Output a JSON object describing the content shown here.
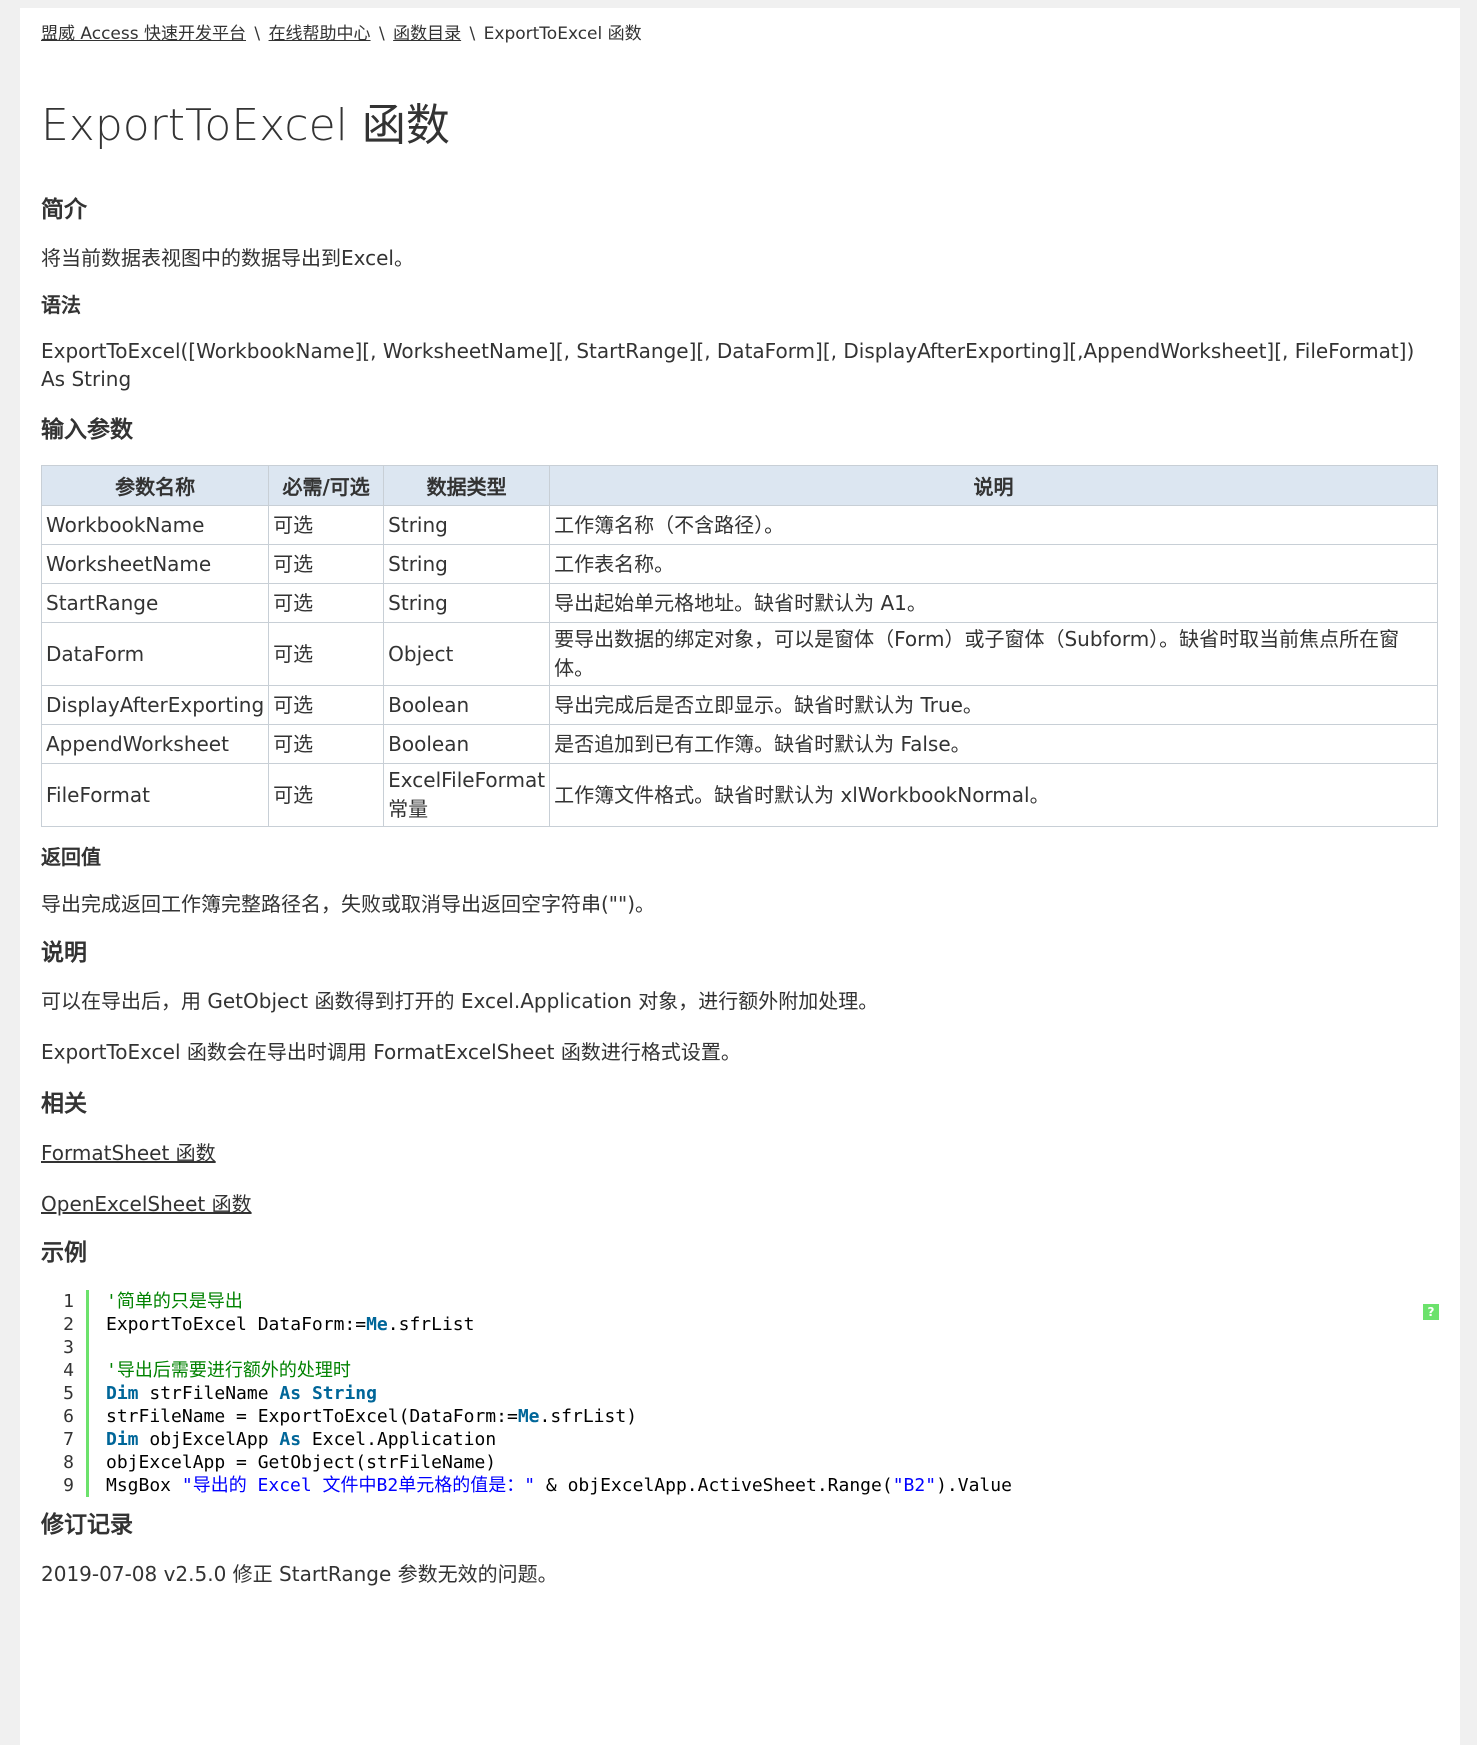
{
  "breadcrumb": {
    "items": [
      "盟威 Access 快速开发平台",
      "在线帮助中心",
      "函数目录"
    ],
    "separator": "\\",
    "current": "ExportToExcel 函数"
  },
  "title": "ExportToExcel 函数",
  "sections": {
    "summary": {
      "heading": "简介",
      "text": "将当前数据表视图中的数据导出到Excel。"
    },
    "syntax": {
      "heading": "语法",
      "text": "ExportToExcel([WorkbookName][, WorksheetName][, StartRange][, DataForm][, DisplayAfterExporting][,AppendWorksheet][, FileFormat]) As String"
    },
    "params": {
      "heading": "输入参数",
      "headers": [
        "参数名称",
        "必需/可选",
        "数据类型",
        "说明"
      ],
      "rows": [
        [
          "WorkbookName",
          "可选",
          "String",
          "工作簿名称（不含路径）。"
        ],
        [
          "WorksheetName",
          "可选",
          "String",
          "工作表名称。"
        ],
        [
          "StartRange",
          "可选",
          "String",
          "导出起始单元格地址。缺省时默认为 A1。"
        ],
        [
          "DataForm",
          "可选",
          "Object",
          "要导出数据的绑定对象，可以是窗体（Form）或子窗体（Subform）。缺省时取当前焦点所在窗体。"
        ],
        [
          "DisplayAfterExporting",
          "可选",
          "Boolean",
          "导出完成后是否立即显示。缺省时默认为 True。"
        ],
        [
          "AppendWorksheet",
          "可选",
          "Boolean",
          "是否追加到已有工作簿。缺省时默认为 False。"
        ],
        [
          "FileFormat",
          "可选",
          "ExcelFileFormat 常量",
          "工作簿文件格式。缺省时默认为 xlWorkbookNormal。"
        ]
      ]
    },
    "returns": {
      "heading": "返回值",
      "text": "导出完成返回工作簿完整路径名，失败或取消导出返回空字符串(\"\")。"
    },
    "remarks": {
      "heading": "说明",
      "p1": "可以在导出后，用 GetObject 函数得到打开的 Excel.Application 对象，进行额外附加处理。",
      "p2": "ExportToExcel 函数会在导出时调用 FormatExcelSheet 函数进行格式设置。"
    },
    "related": {
      "heading": "相关",
      "links": [
        "FormatSheet 函数",
        "OpenExcelSheet 函数"
      ]
    },
    "example": {
      "heading": "示例",
      "lines": [
        {
          "n": "1",
          "parts": [
            [
              "cm",
              "'简单的只是导出"
            ]
          ]
        },
        {
          "n": "2",
          "parts": [
            [
              "",
              "ExportToExcel DataForm:="
            ],
            [
              "kw",
              "Me"
            ],
            [
              "",
              ".sfrList"
            ]
          ]
        },
        {
          "n": "3",
          "parts": [
            [
              "",
              " "
            ]
          ]
        },
        {
          "n": "4",
          "parts": [
            [
              "cm",
              "'导出后需要进行额外的处理时"
            ]
          ]
        },
        {
          "n": "5",
          "parts": [
            [
              "kw",
              "Dim"
            ],
            [
              "",
              " strFileName "
            ],
            [
              "kw",
              "As"
            ],
            [
              "",
              " "
            ],
            [
              "kw",
              "String"
            ]
          ]
        },
        {
          "n": "6",
          "parts": [
            [
              "",
              "strFileName = ExportToExcel(DataForm:="
            ],
            [
              "kw",
              "Me"
            ],
            [
              "",
              ".sfrList)"
            ]
          ]
        },
        {
          "n": "7",
          "parts": [
            [
              "kw",
              "Dim"
            ],
            [
              "",
              " objExcelApp "
            ],
            [
              "kw",
              "As"
            ],
            [
              "",
              " Excel.Application"
            ]
          ]
        },
        {
          "n": "8",
          "parts": [
            [
              "",
              "objExcelApp = GetObject(strFileName)"
            ]
          ]
        },
        {
          "n": "9",
          "parts": [
            [
              "",
              "MsgBox "
            ],
            [
              "st",
              "\"导出的 Excel 文件中B2单元格的值是：\""
            ],
            [
              "",
              " & objExcelApp.ActiveSheet.Range("
            ],
            [
              "st",
              "\"B2\""
            ],
            [
              "",
              ").Value"
            ]
          ]
        }
      ],
      "help_icon": "?"
    },
    "revisions": {
      "heading": "修订记录",
      "text": "2019-07-08 v2.5.0 修正 StartRange 参数无效的问题。"
    }
  }
}
